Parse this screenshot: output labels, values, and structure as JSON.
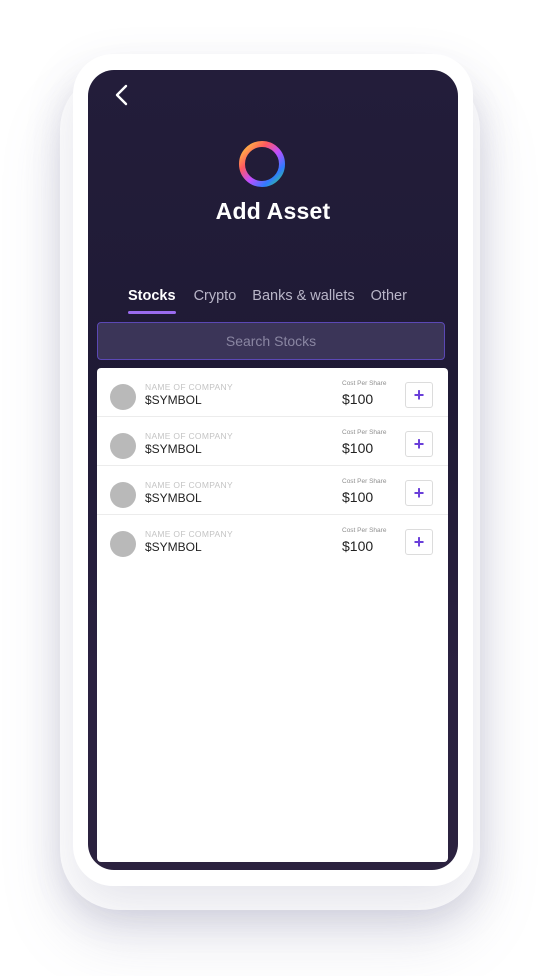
{
  "header": {
    "back_icon": "chevron-left-icon",
    "logo_icon": "ring-logo-icon",
    "title": "Add Asset"
  },
  "tabs": [
    {
      "label": "Stocks",
      "active": true
    },
    {
      "label": "Crypto",
      "active": false
    },
    {
      "label": "Banks & wallets",
      "active": false
    },
    {
      "label": "Other",
      "active": false
    }
  ],
  "search": {
    "placeholder": "Search Stocks"
  },
  "assets": [
    {
      "company": "NAME OF COMPANY",
      "symbol": "$SYMBOL",
      "price_caption": "Cost Per Share",
      "price": "$100",
      "add_label": "+"
    },
    {
      "company": "NAME OF COMPANY",
      "symbol": "$SYMBOL",
      "price_caption": "Cost Per Share",
      "price": "$100",
      "add_label": "+"
    },
    {
      "company": "NAME OF COMPANY",
      "symbol": "$SYMBOL",
      "price_caption": "Cost Per Share",
      "price": "$100",
      "add_label": "+"
    },
    {
      "company": "NAME OF COMPANY",
      "symbol": "$SYMBOL",
      "price_caption": "Cost Per Share",
      "price": "$100",
      "add_label": "+"
    }
  ],
  "colors": {
    "accent": "#9b6cf0",
    "plus": "#6a3fd9",
    "background_top": "#231d3a"
  }
}
